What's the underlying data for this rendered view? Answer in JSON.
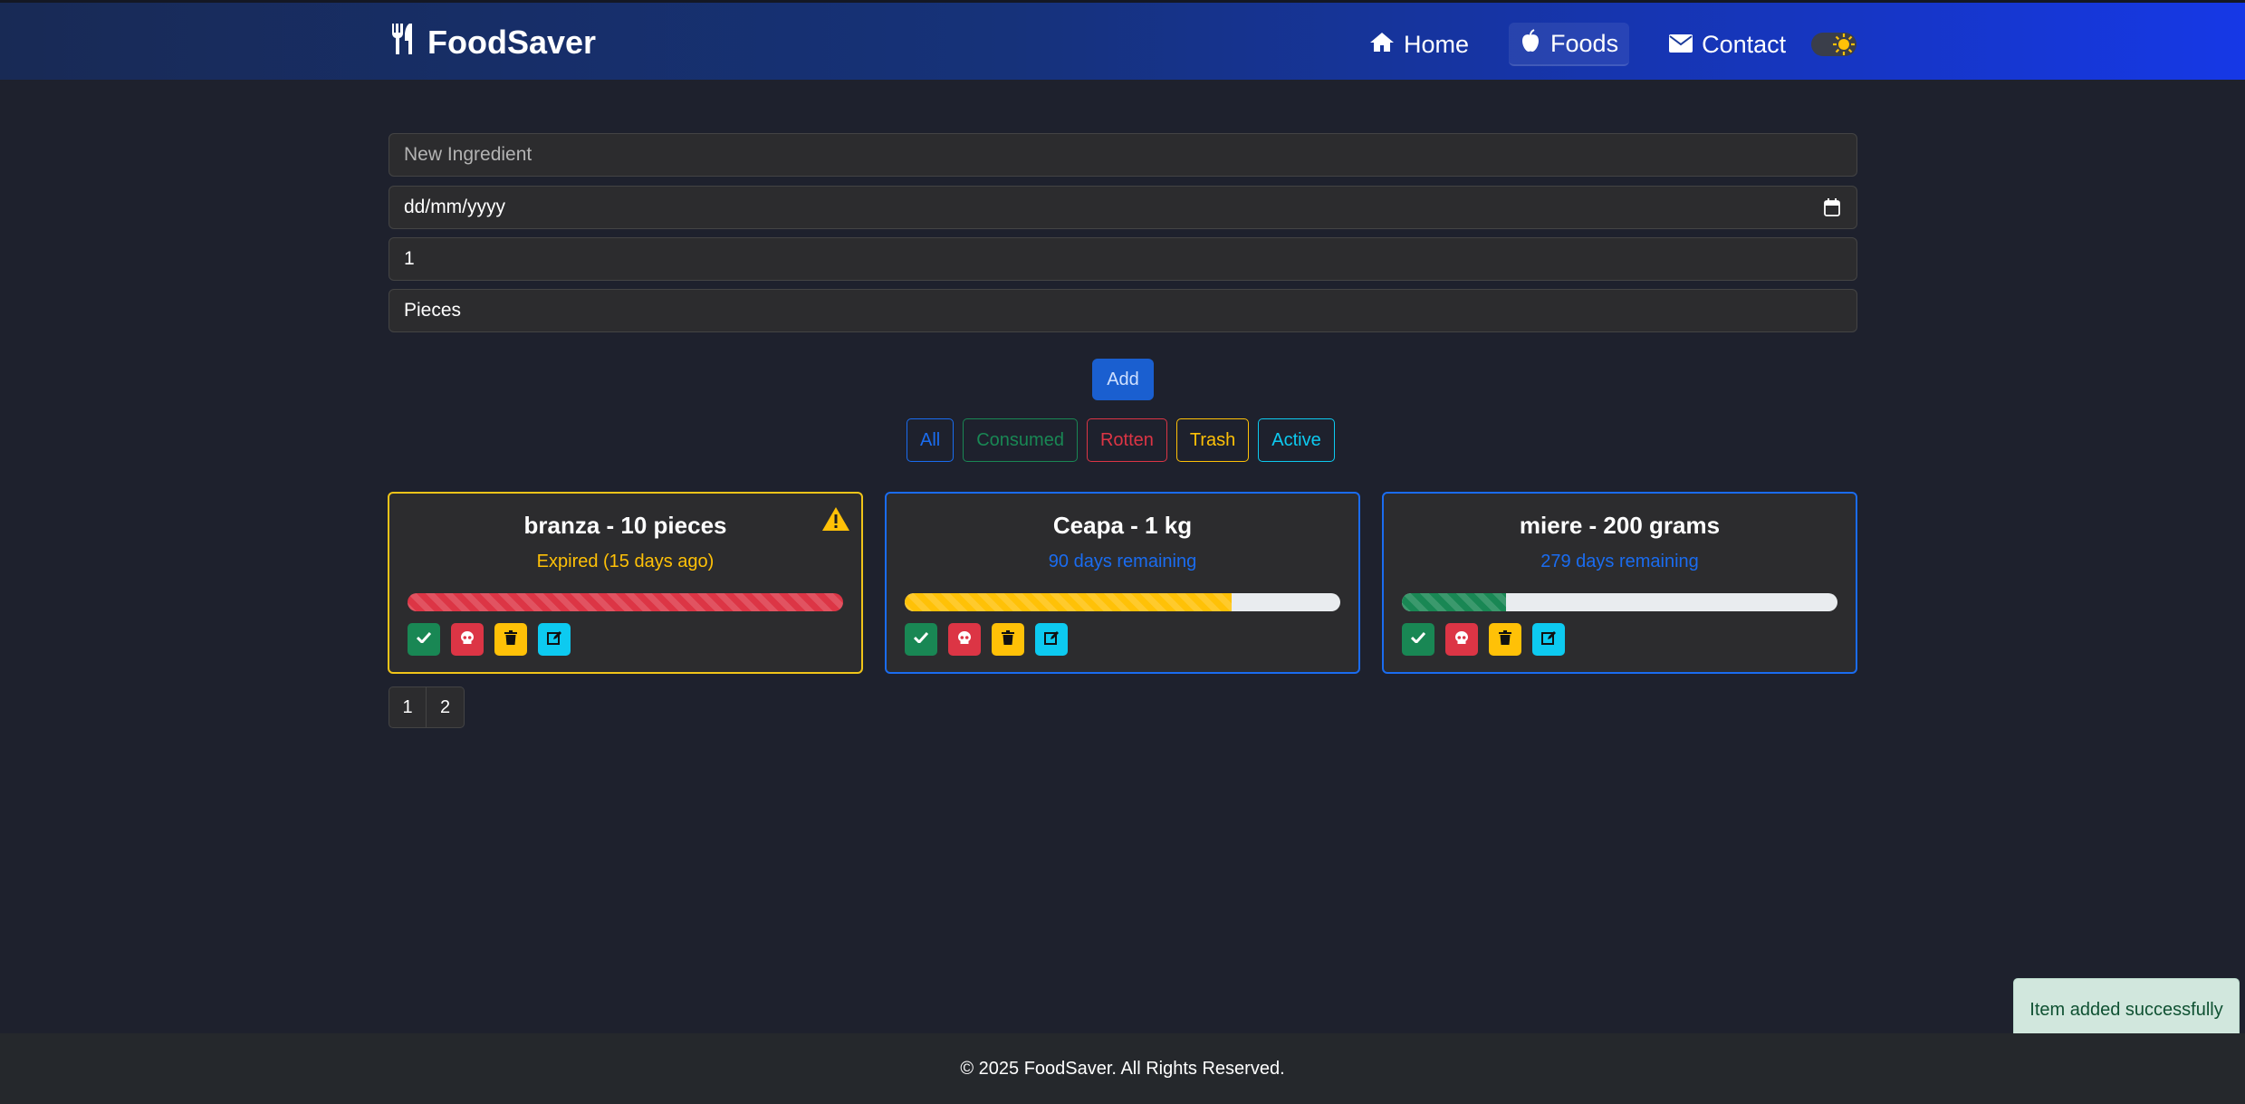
{
  "navbar": {
    "brand": "FoodSaver",
    "links": [
      {
        "label": "Home",
        "icon": "home-icon"
      },
      {
        "label": "Foods",
        "icon": "apple-icon",
        "active": true
      },
      {
        "label": "Contact",
        "icon": "envelope-icon"
      }
    ],
    "theme_toggle_icon": "sun-icon"
  },
  "form": {
    "ingredient_placeholder": "New Ingredient",
    "date_placeholder": "dd/mm/yyyy",
    "quantity_value": "1",
    "unit_value": "Pieces",
    "add_label": "Add"
  },
  "filters": [
    {
      "label": "All",
      "color": "#1a6cf0"
    },
    {
      "label": "Consumed",
      "color": "#198754"
    },
    {
      "label": "Rotten",
      "color": "#dc3545"
    },
    {
      "label": "Trash",
      "color": "#ffc107"
    },
    {
      "label": "Active",
      "color": "#0dcaf0"
    }
  ],
  "cards": [
    {
      "title": "branza - 10 pieces",
      "status": "Expired (15 days ago)",
      "status_color": "#ffc107",
      "progress": 100,
      "bar_color": "#dc3545",
      "warning": true
    },
    {
      "title": "Ceapa - 1 kg",
      "status": "90 days remaining",
      "status_color": "#1a6cf0",
      "progress": 75,
      "bar_color": "#ffc107",
      "warning": false
    },
    {
      "title": "miere - 200 grams",
      "status": "279 days remaining",
      "status_color": "#1a6cf0",
      "progress": 24,
      "bar_color": "#198754",
      "warning": false
    }
  ],
  "card_actions": [
    {
      "icon": "check-icon",
      "color": "#198754"
    },
    {
      "icon": "skull-icon",
      "color": "#dc3545"
    },
    {
      "icon": "trash-icon",
      "color": "#ffc107"
    },
    {
      "icon": "edit-icon",
      "color": "#0dcaf0"
    }
  ],
  "pagination": [
    "1",
    "2"
  ],
  "toast": "Item added successfully",
  "footer": "© 2025 FoodSaver. All Rights Reserved."
}
